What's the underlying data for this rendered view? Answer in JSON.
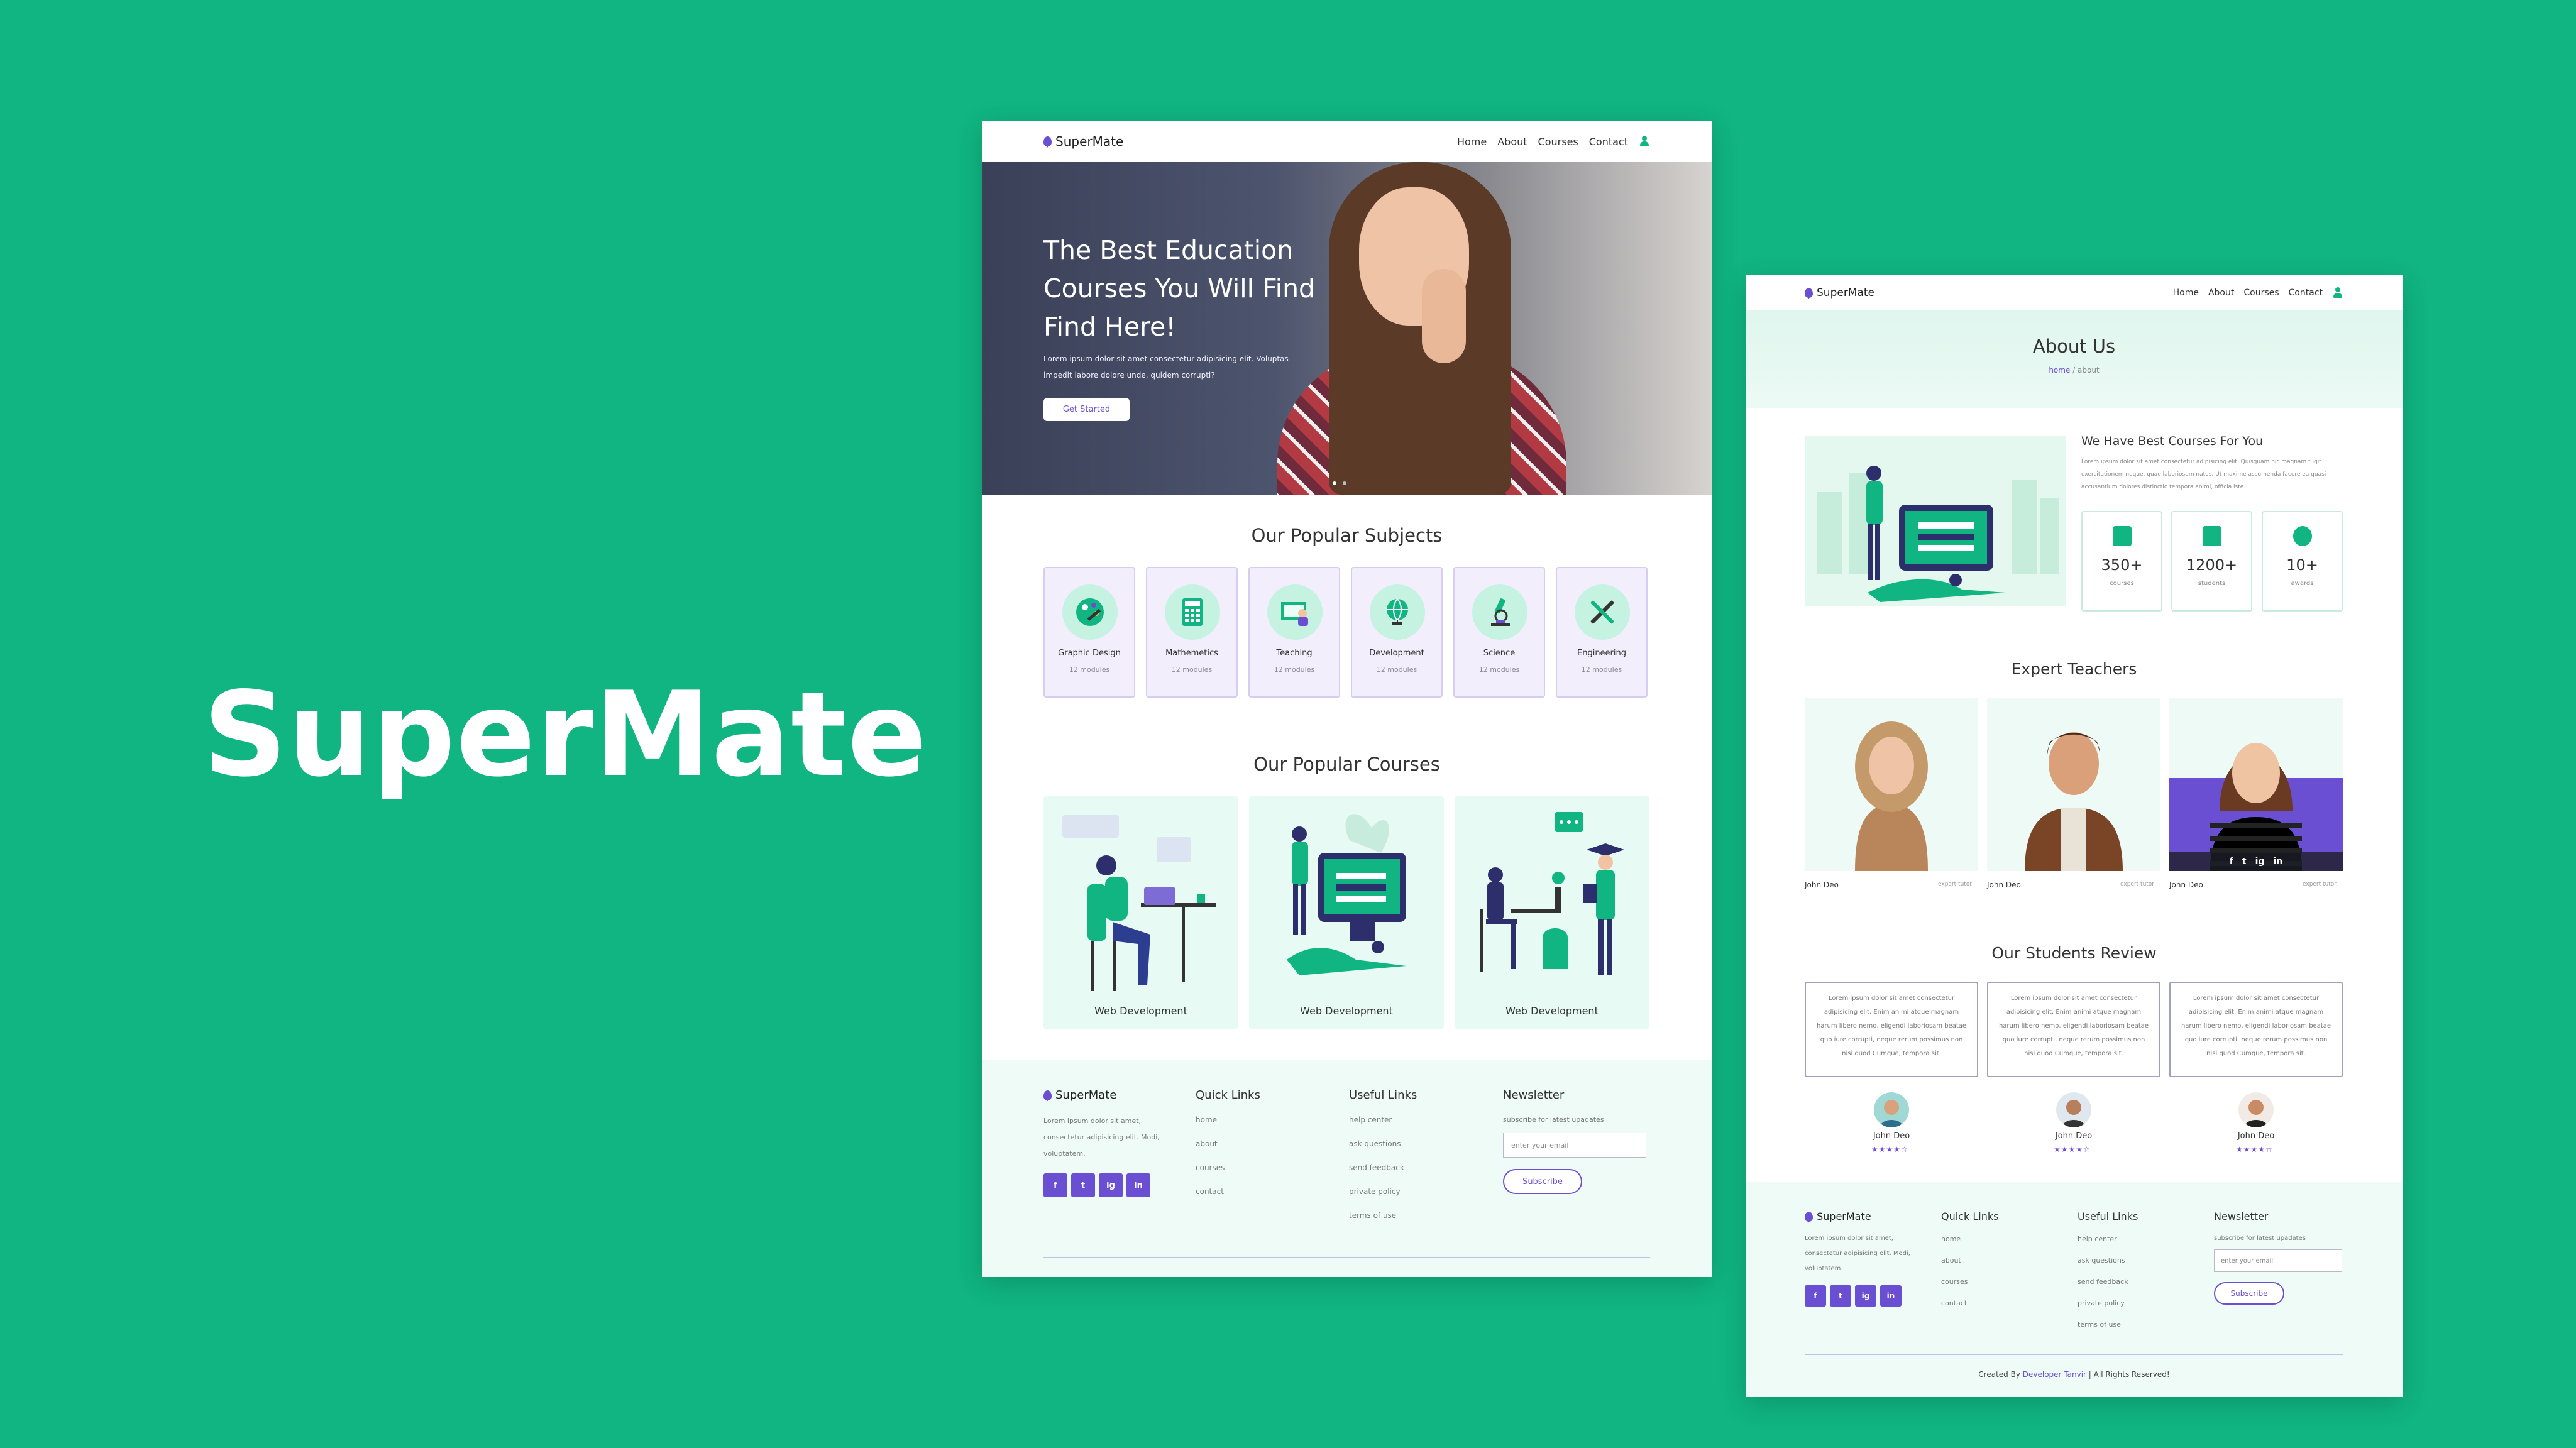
{
  "brand": {
    "title": "SuperMate"
  },
  "colors": {
    "background": "#10b581",
    "accent": "#6b4fd3",
    "green": "#10b581"
  },
  "nav": {
    "logo": "SuperMate",
    "items": [
      "Home",
      "About",
      "Courses",
      "Contact"
    ],
    "user_icon": "user-icon"
  },
  "hero": {
    "title": "The Best Education Courses You Will Find Find Here!",
    "text": "Lorem ipsum dolor sit amet consectetur adipisicing elit. Voluptas impedit labore dolore unde, quidem corrupti?",
    "button": "Get Started"
  },
  "subjects": {
    "title": "Our Popular Subjects",
    "items": [
      {
        "name": "Graphic Design",
        "modules": "12 modules",
        "icon": "palette-icon"
      },
      {
        "name": "Mathemetics",
        "modules": "12 modules",
        "icon": "calculator-icon"
      },
      {
        "name": "Teaching",
        "modules": "12 modules",
        "icon": "teacher-board-icon"
      },
      {
        "name": "Development",
        "modules": "12 modules",
        "icon": "globe-icon"
      },
      {
        "name": "Science",
        "modules": "12 modules",
        "icon": "microscope-icon"
      },
      {
        "name": "Engineering",
        "modules": "12 modules",
        "icon": "tools-icon"
      }
    ]
  },
  "courses": {
    "title": "Our Popular Courses",
    "items": [
      {
        "name": "Web Development"
      },
      {
        "name": "Web Development"
      },
      {
        "name": "Web Development"
      }
    ]
  },
  "footer": {
    "logo": "SuperMate",
    "about": "Lorem ipsum dolor sit amet, consectetur adipisicing elit. Modi, voluptatem.",
    "social": [
      "f",
      "t",
      "ig",
      "in"
    ],
    "quick_links_title": "Quick Links",
    "quick_links": [
      "home",
      "about",
      "courses",
      "contact"
    ],
    "useful_links_title": "Useful Links",
    "useful_links": [
      "help center",
      "ask questions",
      "send feedback",
      "private policy",
      "terms of use"
    ],
    "newsletter_title": "Newsletter",
    "newsletter_text": "subscribe for latest upadates",
    "email_placeholder": "enter your email",
    "subscribe": "Subscribe",
    "credit_prefix": "Created By",
    "credit_name": "Developer Tanvir",
    "credit_suffix": "| All Rights Reserved!"
  },
  "about": {
    "title": "About Us",
    "crumb_home": "home",
    "crumb_sep": "/",
    "crumb_current": "about",
    "heading": "We Have Best Courses For You",
    "text": "Lorem ipsum dolor sit amet consectetur adipisicing elit. Quisquam hic magnam fugit exercitationem neque, quae laboriosam natus. Ut maxime assumenda facere ea quasi accusantium dolores distinctio tempora animi, officia iste.",
    "stats": [
      {
        "value": "350+",
        "label": "courses",
        "icon": "book-icon"
      },
      {
        "value": "1200+",
        "label": "students",
        "icon": "reader-icon"
      },
      {
        "value": "10+",
        "label": "awards",
        "icon": "medal-icon"
      }
    ]
  },
  "teachers": {
    "title": "Expert Teachers",
    "items": [
      {
        "name": "John Deo",
        "role": "expert tutor"
      },
      {
        "name": "John Deo",
        "role": "expert tutor"
      },
      {
        "name": "John Deo",
        "role": "expert tutor"
      }
    ]
  },
  "reviews": {
    "title": "Our Students Review",
    "text": "Lorem ipsum dolor sit amet consectetur adipisicing elit. Enim animi atque magnam harum libero nemo, eligendi laboriosam beatae quo iure corrupti, neque rerum possimus non nisi quod Cumque, tempora sit.",
    "items": [
      {
        "name": "John Deo",
        "rating": "★★★★☆"
      },
      {
        "name": "John Deo",
        "rating": "★★★★☆"
      },
      {
        "name": "John Deo",
        "rating": "★★★★☆"
      }
    ]
  }
}
